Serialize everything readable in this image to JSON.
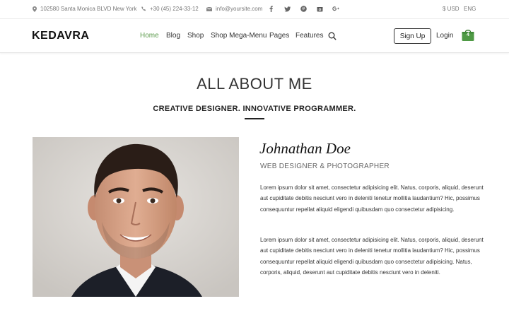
{
  "topbar": {
    "address": "102580 Santa Monica BLVD New York",
    "phone": "+30 (45) 224-33-12",
    "email": "info@yoursite.com",
    "social_icons": [
      "facebook-icon",
      "twitter-icon",
      "pinterest-icon",
      "instagram-icon",
      "google-plus-icon"
    ],
    "currency": "$ USD",
    "language": "ENG"
  },
  "header": {
    "logo": "KEDAVRA",
    "nav": [
      "Home",
      "Blog",
      "Shop",
      "Shop Mega-Menu",
      "Pages",
      "Features"
    ],
    "active_nav": "Home",
    "signup": "Sign Up",
    "login": "Login",
    "cart_count": "4"
  },
  "section": {
    "title": "ALL ABOUT ME",
    "subtitle": "CREATIVE DESIGNER. INNOVATIVE PROGRAMMER."
  },
  "profile": {
    "name": "Johnathan Doe",
    "role": "WEB DESIGNER & PHOTOGRAPHER",
    "paragraph1": "Lorem ipsum dolor sit amet, consectetur adipisicing elit. Natus, corporis, aliquid, deserunt aut cupiditate debitis nesciunt vero in deleniti tenetur mollitia laudantium? Hic, possimus consequuntur repellat aliquid eligendi quibusdam quo consectetur adipisicing.",
    "paragraph2": "Lorem ipsum dolor sit amet, consectetur adipisicing elit. Natus, corporis, aliquid, deserunt aut cupiditate debitis nesciunt vero in deleniti tenetur mollitia laudantium? Hic, possimus consequuntur repellat aliquid eligendi quibusdam quo consectetur adipisicing. Natus, corporis, aliquid, deserunt aut cupiditate debitis nesciunt vero in deleniti."
  },
  "colors": {
    "accent": "#5b9a4b",
    "cart": "#4f9a45",
    "text": "#333333"
  }
}
